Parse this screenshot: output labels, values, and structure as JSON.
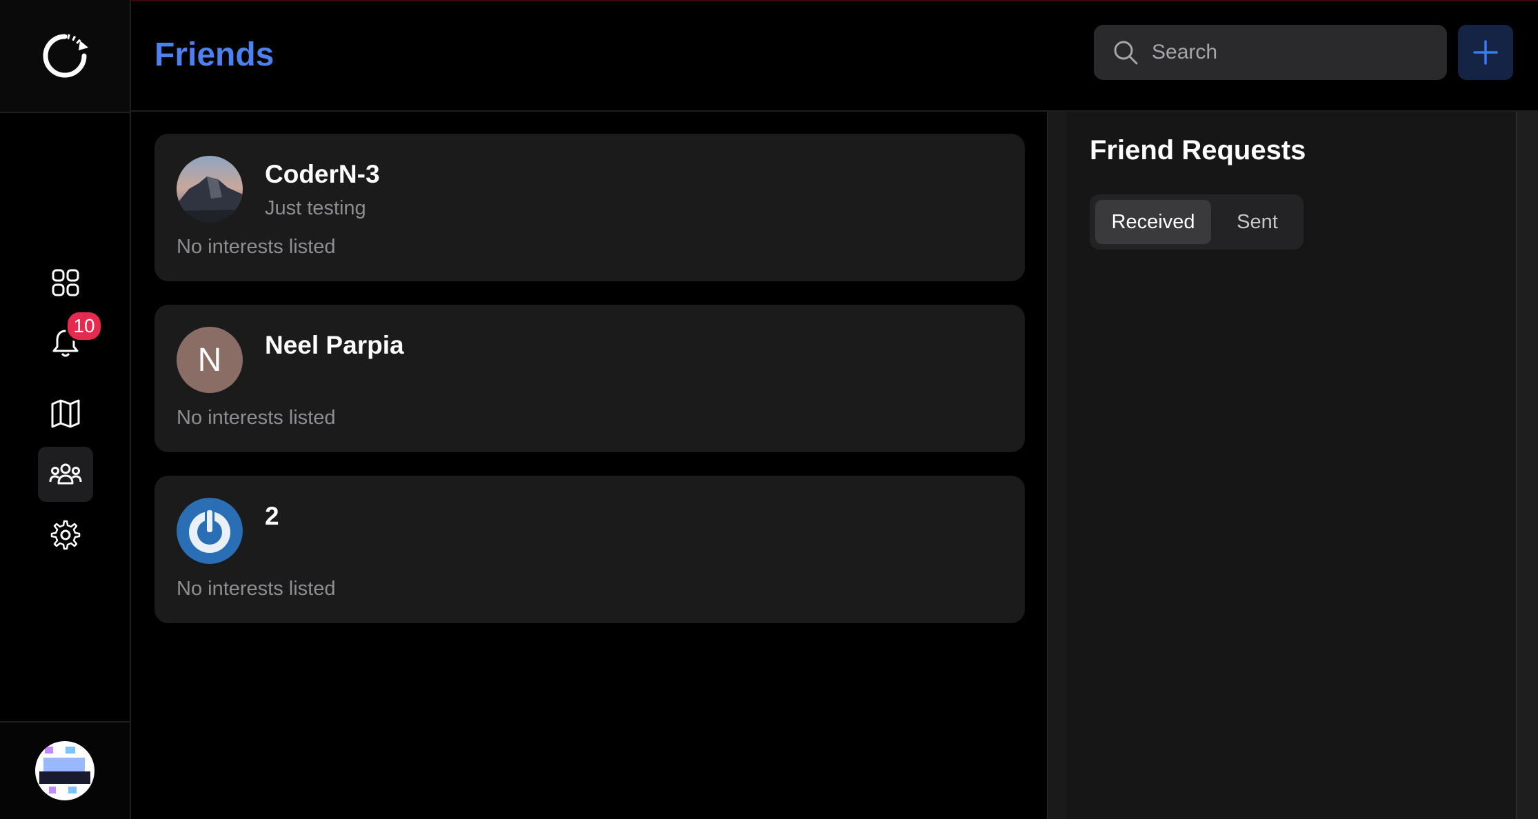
{
  "header": {
    "title": "Friends",
    "search_placeholder": "Search",
    "search_value": ""
  },
  "sidebar": {
    "items": [
      {
        "name": "dashboard",
        "icon": "grid-icon"
      },
      {
        "name": "notifications",
        "icon": "bell-icon",
        "badge": "10"
      },
      {
        "name": "map",
        "icon": "map-icon"
      },
      {
        "name": "friends",
        "icon": "users-icon",
        "active": true
      },
      {
        "name": "settings",
        "icon": "gear-icon"
      }
    ]
  },
  "friends": [
    {
      "name": "CoderN-3",
      "status": "Just testing",
      "interests": "No interests listed",
      "avatar": "photo"
    },
    {
      "name": "Neel Parpia",
      "status": "",
      "interests": "No interests listed",
      "avatar_letter": "N"
    },
    {
      "name": "2",
      "status": "",
      "interests": "No interests listed",
      "avatar": "power-icon"
    }
  ],
  "requests": {
    "title": "Friend Requests",
    "tabs": [
      "Received",
      "Sent"
    ],
    "active_tab": "Received"
  },
  "colors": {
    "accent": "#4b82f0",
    "badge": "#e5294f",
    "card": "#1b1b1c"
  }
}
